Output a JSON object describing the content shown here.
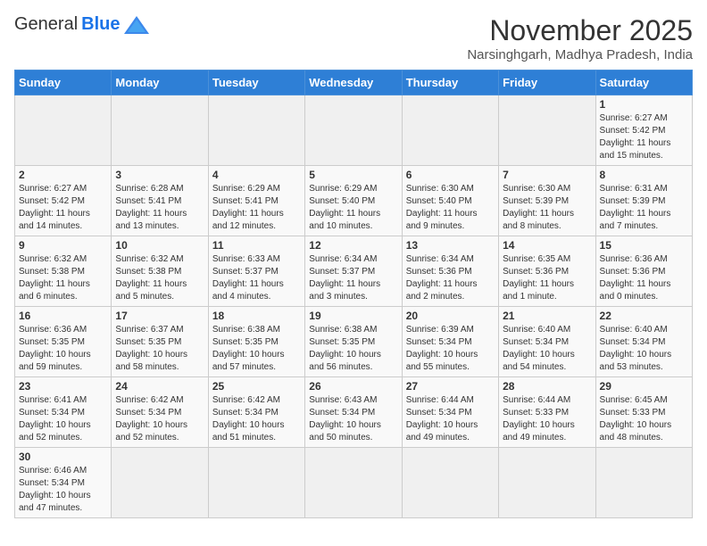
{
  "header": {
    "logo_general": "General",
    "logo_blue": "Blue",
    "month": "November 2025",
    "location": "Narsinghgarh, Madhya Pradesh, India"
  },
  "weekdays": [
    "Sunday",
    "Monday",
    "Tuesday",
    "Wednesday",
    "Thursday",
    "Friday",
    "Saturday"
  ],
  "weeks": [
    [
      {
        "day": "",
        "info": ""
      },
      {
        "day": "",
        "info": ""
      },
      {
        "day": "",
        "info": ""
      },
      {
        "day": "",
        "info": ""
      },
      {
        "day": "",
        "info": ""
      },
      {
        "day": "",
        "info": ""
      },
      {
        "day": "1",
        "info": "Sunrise: 6:27 AM\nSunset: 5:42 PM\nDaylight: 11 hours\nand 15 minutes."
      }
    ],
    [
      {
        "day": "2",
        "info": "Sunrise: 6:27 AM\nSunset: 5:42 PM\nDaylight: 11 hours\nand 14 minutes."
      },
      {
        "day": "3",
        "info": "Sunrise: 6:28 AM\nSunset: 5:41 PM\nDaylight: 11 hours\nand 13 minutes."
      },
      {
        "day": "4",
        "info": "Sunrise: 6:29 AM\nSunset: 5:41 PM\nDaylight: 11 hours\nand 12 minutes."
      },
      {
        "day": "5",
        "info": "Sunrise: 6:29 AM\nSunset: 5:40 PM\nDaylight: 11 hours\nand 10 minutes."
      },
      {
        "day": "6",
        "info": "Sunrise: 6:30 AM\nSunset: 5:40 PM\nDaylight: 11 hours\nand 9 minutes."
      },
      {
        "day": "7",
        "info": "Sunrise: 6:30 AM\nSunset: 5:39 PM\nDaylight: 11 hours\nand 8 minutes."
      },
      {
        "day": "8",
        "info": "Sunrise: 6:31 AM\nSunset: 5:39 PM\nDaylight: 11 hours\nand 7 minutes."
      }
    ],
    [
      {
        "day": "9",
        "info": "Sunrise: 6:32 AM\nSunset: 5:38 PM\nDaylight: 11 hours\nand 6 minutes."
      },
      {
        "day": "10",
        "info": "Sunrise: 6:32 AM\nSunset: 5:38 PM\nDaylight: 11 hours\nand 5 minutes."
      },
      {
        "day": "11",
        "info": "Sunrise: 6:33 AM\nSunset: 5:37 PM\nDaylight: 11 hours\nand 4 minutes."
      },
      {
        "day": "12",
        "info": "Sunrise: 6:34 AM\nSunset: 5:37 PM\nDaylight: 11 hours\nand 3 minutes."
      },
      {
        "day": "13",
        "info": "Sunrise: 6:34 AM\nSunset: 5:36 PM\nDaylight: 11 hours\nand 2 minutes."
      },
      {
        "day": "14",
        "info": "Sunrise: 6:35 AM\nSunset: 5:36 PM\nDaylight: 11 hours\nand 1 minute."
      },
      {
        "day": "15",
        "info": "Sunrise: 6:36 AM\nSunset: 5:36 PM\nDaylight: 11 hours\nand 0 minutes."
      }
    ],
    [
      {
        "day": "16",
        "info": "Sunrise: 6:36 AM\nSunset: 5:35 PM\nDaylight: 10 hours\nand 59 minutes."
      },
      {
        "day": "17",
        "info": "Sunrise: 6:37 AM\nSunset: 5:35 PM\nDaylight: 10 hours\nand 58 minutes."
      },
      {
        "day": "18",
        "info": "Sunrise: 6:38 AM\nSunset: 5:35 PM\nDaylight: 10 hours\nand 57 minutes."
      },
      {
        "day": "19",
        "info": "Sunrise: 6:38 AM\nSunset: 5:35 PM\nDaylight: 10 hours\nand 56 minutes."
      },
      {
        "day": "20",
        "info": "Sunrise: 6:39 AM\nSunset: 5:34 PM\nDaylight: 10 hours\nand 55 minutes."
      },
      {
        "day": "21",
        "info": "Sunrise: 6:40 AM\nSunset: 5:34 PM\nDaylight: 10 hours\nand 54 minutes."
      },
      {
        "day": "22",
        "info": "Sunrise: 6:40 AM\nSunset: 5:34 PM\nDaylight: 10 hours\nand 53 minutes."
      }
    ],
    [
      {
        "day": "23",
        "info": "Sunrise: 6:41 AM\nSunset: 5:34 PM\nDaylight: 10 hours\nand 52 minutes."
      },
      {
        "day": "24",
        "info": "Sunrise: 6:42 AM\nSunset: 5:34 PM\nDaylight: 10 hours\nand 52 minutes."
      },
      {
        "day": "25",
        "info": "Sunrise: 6:42 AM\nSunset: 5:34 PM\nDaylight: 10 hours\nand 51 minutes."
      },
      {
        "day": "26",
        "info": "Sunrise: 6:43 AM\nSunset: 5:34 PM\nDaylight: 10 hours\nand 50 minutes."
      },
      {
        "day": "27",
        "info": "Sunrise: 6:44 AM\nSunset: 5:34 PM\nDaylight: 10 hours\nand 49 minutes."
      },
      {
        "day": "28",
        "info": "Sunrise: 6:44 AM\nSunset: 5:33 PM\nDaylight: 10 hours\nand 49 minutes."
      },
      {
        "day": "29",
        "info": "Sunrise: 6:45 AM\nSunset: 5:33 PM\nDaylight: 10 hours\nand 48 minutes."
      }
    ],
    [
      {
        "day": "30",
        "info": "Sunrise: 6:46 AM\nSunset: 5:34 PM\nDaylight: 10 hours\nand 47 minutes."
      },
      {
        "day": "",
        "info": ""
      },
      {
        "day": "",
        "info": ""
      },
      {
        "day": "",
        "info": ""
      },
      {
        "day": "",
        "info": ""
      },
      {
        "day": "",
        "info": ""
      },
      {
        "day": "",
        "info": ""
      }
    ]
  ]
}
